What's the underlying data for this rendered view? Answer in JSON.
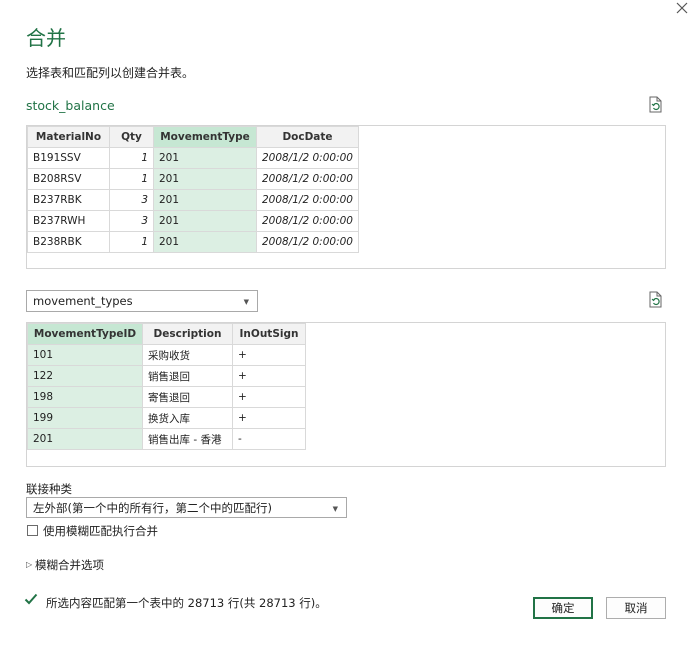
{
  "dialog": {
    "title": "合并",
    "subtitle": "选择表和匹配列以创建合并表。",
    "close_icon": "close-icon"
  },
  "table1": {
    "name": "stock_balance",
    "columns": [
      "MaterialNo",
      "Qty",
      "MovementType",
      "DocDate"
    ],
    "rows": [
      [
        "B191SSV",
        "1",
        "201",
        "2008/1/2 0:00:00"
      ],
      [
        "B208RSV",
        "1",
        "201",
        "2008/1/2 0:00:00"
      ],
      [
        "B237RBK",
        "3",
        "201",
        "2008/1/2 0:00:00"
      ],
      [
        "B237RWH",
        "3",
        "201",
        "2008/1/2 0:00:00"
      ],
      [
        "B238RBK",
        "1",
        "201",
        "2008/1/2 0:00:00"
      ]
    ]
  },
  "table2": {
    "selected": "movement_types",
    "columns": [
      "MovementTypeID",
      "Description",
      "InOutSign"
    ],
    "rows": [
      [
        "101",
        "采购收货",
        "+"
      ],
      [
        "122",
        "销售退回",
        "+"
      ],
      [
        "198",
        "寄售退回",
        "+"
      ],
      [
        "199",
        "换货入库",
        "+"
      ],
      [
        "201",
        "销售出库 - 香港",
        "-"
      ]
    ]
  },
  "join": {
    "label": "联接种类",
    "selected": "左外部(第一个中的所有行，第二个中的匹配行)",
    "fuzzy_checkbox_label": "使用模糊匹配执行合并",
    "fuzzy_checked": false,
    "fuzzy_options_label": "模糊合并选项"
  },
  "status": {
    "text": "所选内容匹配第一个表中的 28713 行(共 28713 行)。"
  },
  "buttons": {
    "ok": "确定",
    "cancel": "取消"
  },
  "colors": {
    "accent": "#217346",
    "selected_header": "#c6e7d3",
    "selected_cell": "#dcefe3"
  }
}
